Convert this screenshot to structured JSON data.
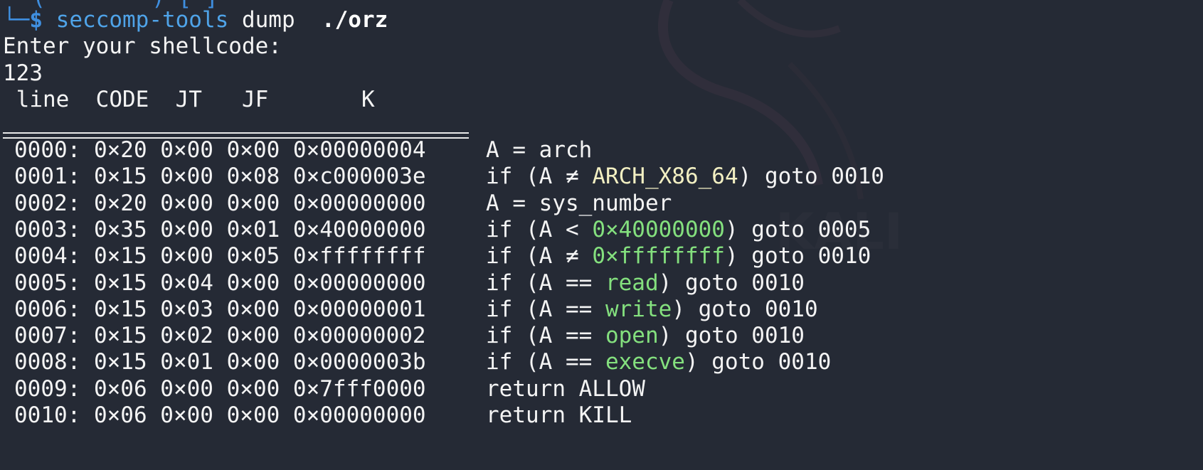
{
  "prompt": {
    "top_fragment": "└─(        )-[ ]",
    "corner": "└─",
    "symbol": "$",
    "command": "seccomp-tools",
    "subcommand": "dump",
    "argument": "./orz"
  },
  "output": {
    "message": "Enter your shellcode:",
    "input_echo": "123"
  },
  "table": {
    "headers": {
      "line": "line",
      "code": "CODE",
      "jt": "JT",
      "jf": "JF",
      "k": "K"
    },
    "rows": [
      {
        "ins": "0000: 0×20 0×00 0×00 0×00000004",
        "pre": "A = arch",
        "hl": "",
        "post": ""
      },
      {
        "ins": "0001: 0×15 0×00 0×08 0×c000003e",
        "pre": "if (A ≠ ",
        "hl": "ARCH_X86_64",
        "post": ") goto 0010"
      },
      {
        "ins": "0002: 0×20 0×00 0×00 0×00000000",
        "pre": "A = sys_number",
        "hl": "",
        "post": ""
      },
      {
        "ins": "0003: 0×35 0×00 0×01 0×40000000",
        "pre": "if (A < ",
        "hl": "0×40000000",
        "post": ") goto 0005"
      },
      {
        "ins": "0004: 0×15 0×00 0×05 0×ffffffff",
        "pre": "if (A ≠ ",
        "hl": "0×ffffffff",
        "post": ") goto 0010"
      },
      {
        "ins": "0005: 0×15 0×04 0×00 0×00000000",
        "pre": "if (A == ",
        "hl": "read",
        "post": ") goto 0010"
      },
      {
        "ins": "0006: 0×15 0×03 0×00 0×00000001",
        "pre": "if (A == ",
        "hl": "write",
        "post": ") goto 0010"
      },
      {
        "ins": "0007: 0×15 0×02 0×00 0×00000002",
        "pre": "if (A == ",
        "hl": "open",
        "post": ") goto 0010"
      },
      {
        "ins": "0008: 0×15 0×01 0×00 0×0000003b",
        "pre": "if (A == ",
        "hl": "execve",
        "post": ") goto 0010"
      },
      {
        "ins": "0009: 0×06 0×00 0×00 0×7fff0000",
        "pre": "return ALLOW",
        "hl": "",
        "post": ""
      },
      {
        "ins": "0010: 0×06 0×00 0×00 0×00000000",
        "pre": "return KILL",
        "hl": "",
        "post": ""
      }
    ]
  },
  "colors": {
    "background": "#252a35",
    "prompt": "#3f8fe0",
    "highlight_constant": "#84e07e",
    "highlight_arch": "#f2efc2"
  }
}
